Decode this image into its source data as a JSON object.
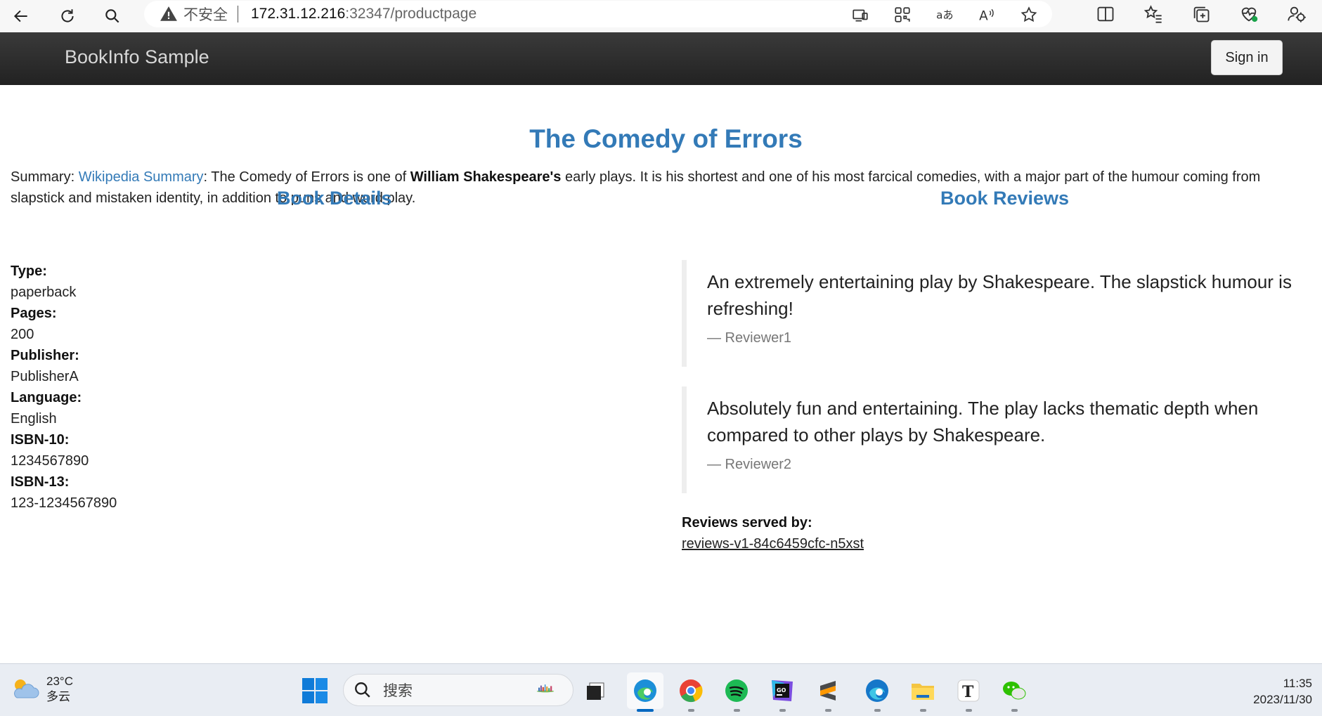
{
  "browser": {
    "security_label": "不安全",
    "url_host": "172.31.12.216",
    "url_path": ":32347/productpage"
  },
  "navbar": {
    "brand": "BookInfo Sample",
    "signin_label": "Sign in"
  },
  "book": {
    "title": "The Comedy of Errors",
    "summary_prefix": "Summary: ",
    "summary_link": "Wikipedia Summary",
    "summary_text_1": ": The Comedy of Errors is one of ",
    "summary_bold": "William Shakespeare's",
    "summary_text_2": " early plays. It is his shortest and one of his most farcical comedies, with a major part of the humour coming from slapstick and mistaken identity, in addition to puns and word play."
  },
  "details": {
    "heading": "Book Details",
    "fields": [
      {
        "label": "Type:",
        "value": "paperback"
      },
      {
        "label": "Pages:",
        "value": "200"
      },
      {
        "label": "Publisher:",
        "value": "PublisherA"
      },
      {
        "label": "Language:",
        "value": "English"
      },
      {
        "label": "ISBN-10:",
        "value": "1234567890"
      },
      {
        "label": "ISBN-13:",
        "value": "123-1234567890"
      }
    ]
  },
  "reviews": {
    "heading": "Book Reviews",
    "items": [
      {
        "text": "An extremely entertaining play by Shakespeare. The slapstick humour is refreshing!",
        "author": "— Reviewer1"
      },
      {
        "text": "Absolutely fun and entertaining. The play lacks thematic depth when compared to other plays by Shakespeare.",
        "author": "— Reviewer2"
      }
    ],
    "served_by_label": "Reviews served by:",
    "served_by_value": "reviews-v1-84c6459cfc-n5xst"
  },
  "taskbar": {
    "temperature": "23°C",
    "weather": "多云",
    "search_placeholder": "搜索",
    "time": "11:35",
    "date": "2023/11/30",
    "apps": [
      "task-view-icon",
      "edge-icon",
      "chrome-icon",
      "spotify-icon",
      "goland-icon",
      "sublime-icon",
      "edge-dev-icon",
      "file-explorer-icon",
      "typora-icon",
      "wechat-icon"
    ]
  },
  "colors": {
    "link": "#337ab7",
    "navbar": "#2b2b2b",
    "taskbar": "#e9edf3"
  }
}
